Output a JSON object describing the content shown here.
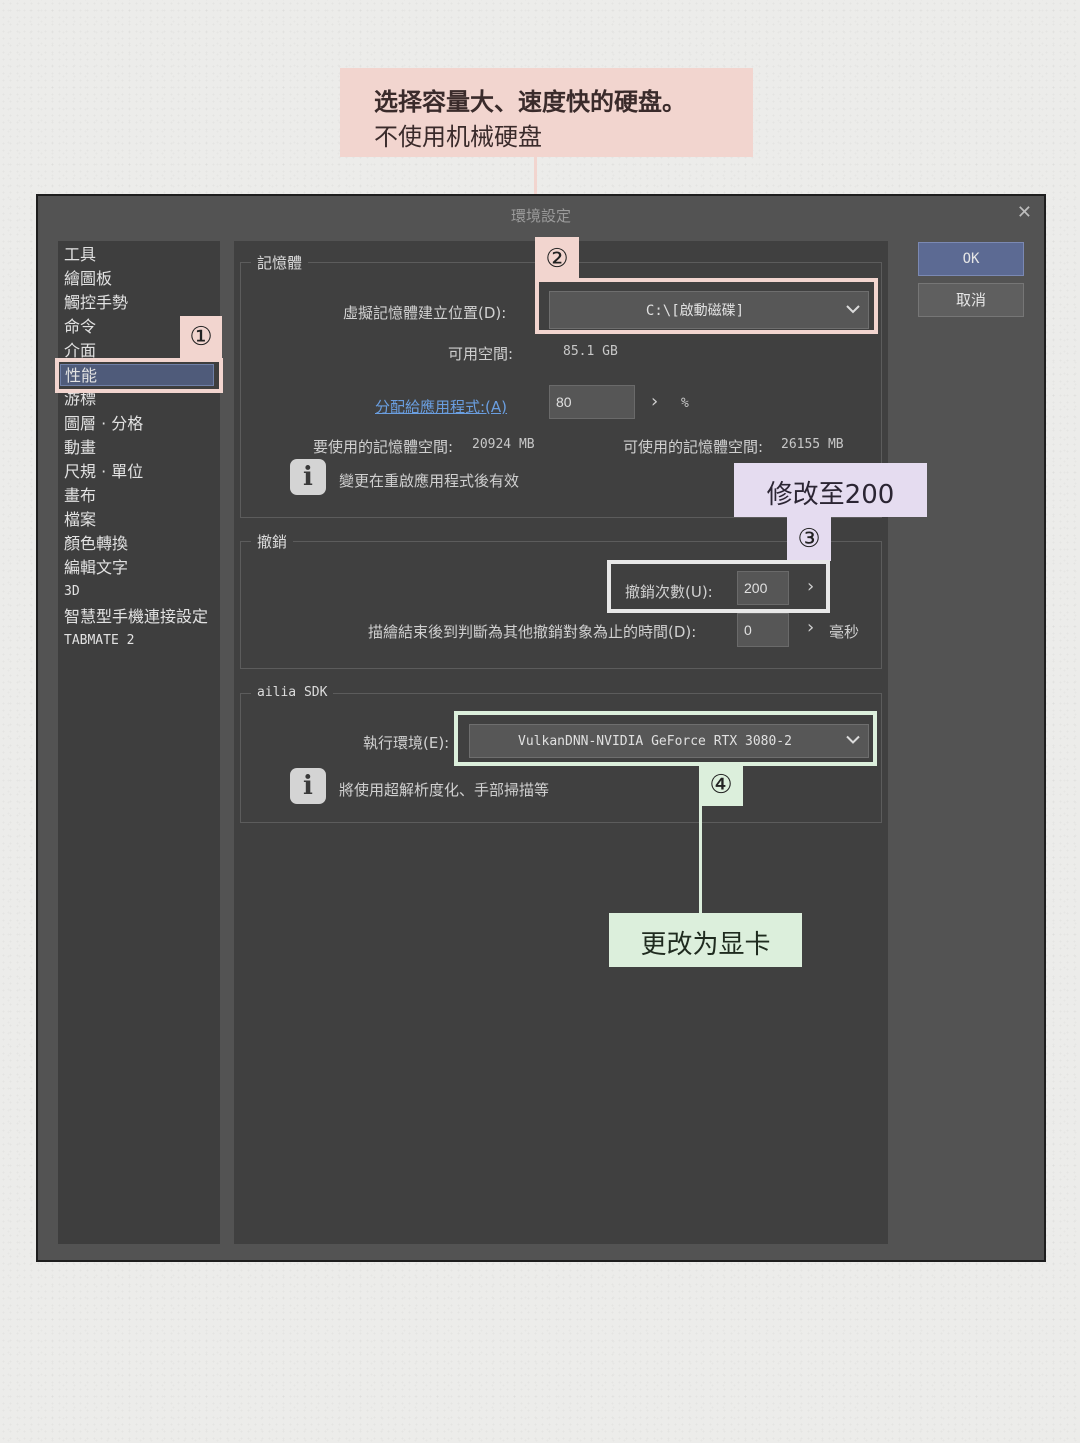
{
  "annotations": {
    "top_note": {
      "line1": "选择容量大、速度快的硬盘。",
      "line2": "不使用机械硬盘"
    },
    "undo_note": "修改至200",
    "gpu_note": "更改为显卡",
    "markers": [
      "①",
      "②",
      "③",
      "④"
    ],
    "colors": {
      "pink": "#f2d5cf",
      "lilac": "#e5dcf0",
      "mint": "#dcefdc"
    }
  },
  "dialog": {
    "title": "環境設定",
    "close_icon": "close-icon",
    "buttons": {
      "ok": "OK",
      "cancel": "取消"
    }
  },
  "categories": [
    "工具",
    "繪圖板",
    "觸控手勢",
    "命令",
    "介面",
    "性能",
    "游標",
    "圖層 · 分格",
    "動畫",
    "尺規 · 單位",
    "畫布",
    "檔案",
    "顏色轉換",
    "編輯文字",
    "3D",
    "智慧型手機連接設定",
    "TABMATE 2"
  ],
  "selected_category": "性能",
  "memory": {
    "legend": "記憶體",
    "vm_label": "虛擬記憶體建立位置(D):",
    "vm_value": "C:\\[啟動磁碟]",
    "free_label": "可用空間:",
    "free_value": "85.1 GB",
    "alloc_link": "分配給應用程式:(A)",
    "alloc_value": "80",
    "alloc_unit": "%",
    "used_label": "要使用的記憶體空間:",
    "used_value": "20924 MB",
    "avail_label": "可使用的記憶體空間:",
    "avail_value": "26155 MB",
    "restart_note": "變更在重啟應用程式後有效"
  },
  "undo": {
    "legend": "撤銷",
    "count_label": "撤銷次數(U):",
    "count_value": "200",
    "time_label": "描繪結束後到判斷為其他撤銷對象為止的時間(D):",
    "time_value": "0",
    "time_unit": "毫秒"
  },
  "ailia": {
    "legend": "ailia SDK",
    "env_label": "執行環境(E):",
    "env_value": "VulkanDNN-NVIDIA GeForce RTX 3080-2",
    "note": "將使用超解析度化、手部掃描等"
  }
}
